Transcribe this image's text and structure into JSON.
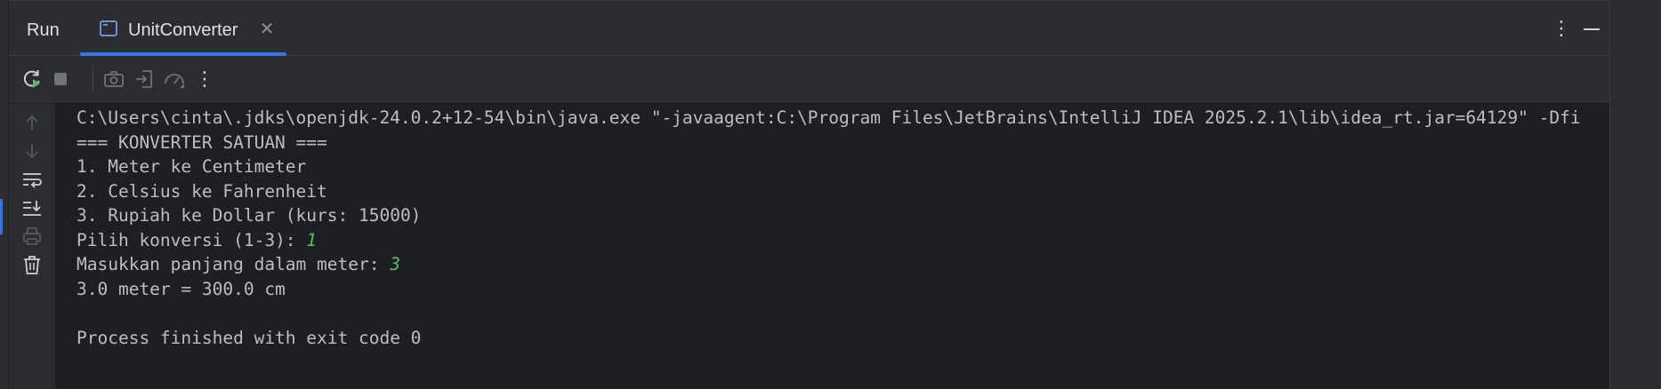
{
  "header": {
    "panel_title": "Run",
    "tab": {
      "label": "UnitConverter",
      "icon": "console-icon",
      "close_glyph": "✕"
    },
    "more_glyph": "⋮",
    "minimize_icon": "minimize-icon"
  },
  "toolbar": {
    "buttons": [
      {
        "name": "rerun-icon",
        "enabled": true
      },
      {
        "name": "stop-icon",
        "enabled": false
      },
      {
        "name": "camera-icon",
        "enabled": false
      },
      {
        "name": "exit-icon",
        "enabled": false
      },
      {
        "name": "profiler-icon",
        "enabled": false
      },
      {
        "name": "more-vertical-icon",
        "enabled": true
      }
    ],
    "more_glyph": "⋮"
  },
  "sidebar": {
    "buttons": [
      {
        "name": "arrow-up-icon",
        "enabled": false
      },
      {
        "name": "arrow-down-icon",
        "enabled": false
      },
      {
        "name": "soft-wrap-icon",
        "enabled": true
      },
      {
        "name": "scroll-to-end-icon",
        "enabled": true
      },
      {
        "name": "print-icon",
        "enabled": false
      },
      {
        "name": "trash-icon",
        "enabled": true
      }
    ]
  },
  "console": {
    "lines": [
      {
        "text": "C:\\Users\\cinta\\.jdks\\openjdk-24.0.2+12-54\\bin\\java.exe \"-javaagent:C:\\Program Files\\JetBrains\\IntelliJ IDEA 2025.2.1\\lib\\idea_rt.jar=64129\" -Dfi"
      },
      {
        "text": "=== KONVERTER SATUAN ==="
      },
      {
        "text": "1. Meter ke Centimeter"
      },
      {
        "text": "2. Celsius ke Fahrenheit"
      },
      {
        "text": "3. Rupiah ke Dollar (kurs: 15000)"
      },
      {
        "text": "Pilih konversi (1-3): ",
        "input": "1"
      },
      {
        "text": "Masukkan panjang dalam meter: ",
        "input": "3"
      },
      {
        "text": "3.0 meter = 300.0 cm"
      },
      {
        "text": ""
      },
      {
        "text": "Process finished with exit code 0"
      }
    ]
  },
  "colors": {
    "background": "#1e1f22",
    "chrome": "#2b2d30",
    "text": "#bcbec4",
    "user_input": "#5fb864",
    "accent": "#3574f0"
  }
}
